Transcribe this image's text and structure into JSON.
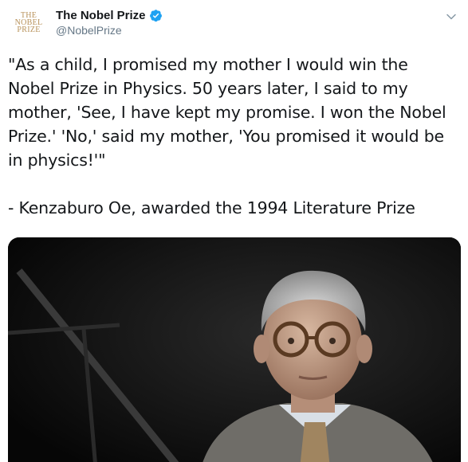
{
  "account": {
    "avatar_text": [
      "THE",
      "NOBEL",
      "PRIZE"
    ],
    "display_name": "The Nobel Prize",
    "handle": "@NobelPrize",
    "verified": true,
    "menu_icon": "chevron-down-icon"
  },
  "tweet": {
    "text": "\"As a child, I promised my mother I would win the Nobel Prize in Physics. 50 years later, I said to my mother, 'See, I have kept my promise. I won the Nobel Prize.' 'No,' said my mother, 'You promised it would be in physics!'\"\n\n- Kenzaburo Oe, awarded the 1994 Literature Prize"
  },
  "colors": {
    "brand_gold": "#b8925a",
    "verified_blue": "#1da1f2",
    "text_primary": "#14171a",
    "text_secondary": "#657786"
  }
}
